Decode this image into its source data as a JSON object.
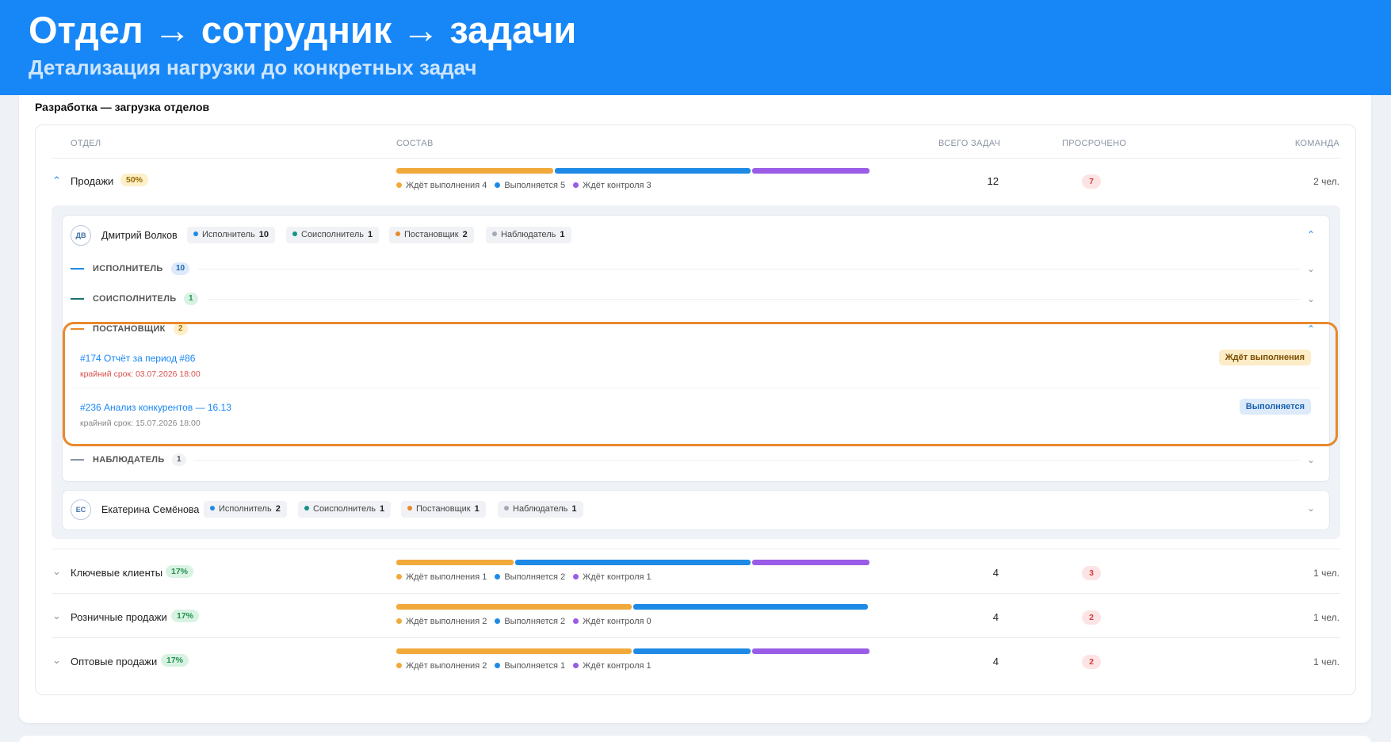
{
  "banner": {
    "title": "Отдел → сотрудник → задачи",
    "subtitle": "Детализация нагрузки до конкретных задач"
  },
  "card": {
    "title": "Разработка — загрузка отделов"
  },
  "table": {
    "headers": [
      "ОТДЕЛ",
      "СОСТАВ",
      "ВСЕГО ЗАДАЧ",
      "ПРОСРОЧЕНО",
      "КОМАНДА"
    ]
  },
  "colors": {
    "waiting": "#f0a93a",
    "running": "#1e8ae6",
    "control": "#9a5ce6",
    "highlight": "#e8892c"
  },
  "departments": [
    {
      "name": "Продажи",
      "pct": "50%",
      "expanded": true,
      "legend": [
        "Ждёт выполнения 4",
        "Выполняется 5",
        "Ждёт контроля 3"
      ],
      "composition": {
        "waiting": 4,
        "running": 5,
        "control": 3
      },
      "total": "12",
      "overdue": "7",
      "team": "2 чел."
    },
    {
      "name": "Ключевые клиенты",
      "pct": "17%",
      "expanded": false,
      "legend": [
        "Ждёт выполнения 1",
        "Выполняется 2",
        "Ждёт контроля 1"
      ],
      "composition": {
        "waiting": 1,
        "running": 2,
        "control": 1
      },
      "total": "4",
      "overdue": "3",
      "team": "1 чел."
    },
    {
      "name": "Розничные продажи",
      "pct": "17%",
      "expanded": false,
      "legend": [
        "Ждёт выполнения 2",
        "Выполняется 2",
        "Ждёт контроля 0"
      ],
      "composition": {
        "waiting": 2,
        "running": 2,
        "control": 0
      },
      "total": "4",
      "overdue": "2",
      "team": "1 чел."
    },
    {
      "name": "Оптовые продажи",
      "pct": "17%",
      "expanded": false,
      "legend": [
        "Ждёт выполнения 2",
        "Выполняется 1",
        "Ждёт контроля 1"
      ],
      "composition": {
        "waiting": 2,
        "running": 1,
        "control": 1
      },
      "total": "4",
      "overdue": "2",
      "team": "1 чел."
    }
  ],
  "employees": [
    {
      "initials": "ДВ",
      "name": "Дмитрий Волков",
      "chips": [
        {
          "label": "Исполнитель",
          "count": "10"
        },
        {
          "label": "Соисполнитель",
          "count": "1"
        },
        {
          "label": "Постановщик",
          "count": "2"
        },
        {
          "label": "Наблюдатель",
          "count": "1"
        }
      ],
      "roles": [
        {
          "name": "ИСПОЛНИТЕЛЬ",
          "count": "10"
        },
        {
          "name": "СОИСПОЛНИТЕЛЬ",
          "count": "1"
        },
        {
          "name": "ПОСТАНОВЩИК",
          "count": "2"
        },
        {
          "name": "НАБЛЮДАТЕЛЬ",
          "count": "1"
        }
      ],
      "tasks": [
        {
          "title": "#174 Отчёт за период #86",
          "due": "крайний срок: 03.07.2026 18:00",
          "status": "Ждёт выполнения"
        },
        {
          "title": "#236 Анализ конкурентов — 16.13",
          "due": "крайний срок: 15.07.2026 18:00",
          "status": "Выполняется"
        }
      ]
    },
    {
      "initials": "ЕС",
      "name": "Екатерина Семёнова",
      "chips": [
        {
          "label": "Исполнитель",
          "count": "2"
        },
        {
          "label": "Соисполнитель",
          "count": "1"
        },
        {
          "label": "Постановщик",
          "count": "1"
        },
        {
          "label": "Наблюдатель",
          "count": "1"
        }
      ]
    }
  ]
}
